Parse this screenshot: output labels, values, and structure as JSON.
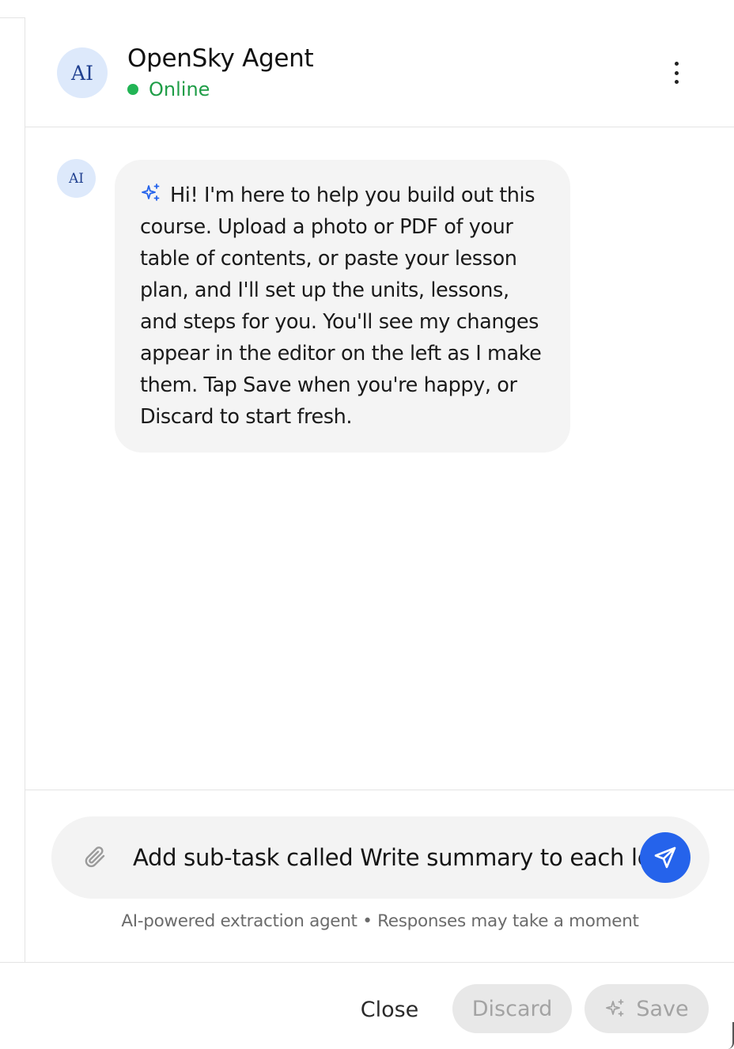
{
  "agent": {
    "avatar_text": "AI",
    "name": "OpenSky Agent",
    "status": "Online",
    "status_color": "#22b455"
  },
  "header": {
    "menu_icon": "more-vertical-icon"
  },
  "messages": [
    {
      "sender": "agent",
      "avatar_text": "AI",
      "icon": "sparkle-icon",
      "text": "Hi! I'm here to help you build out this course. Upload a photo or PDF of your table of contents, or paste your lesson plan, and I'll set up the units, lessons, and steps for you. You'll see my changes appear in the editor on the left as I make them. Tap Save when you're happy, or Discard to start fresh."
    }
  ],
  "composer": {
    "attach_icon": "paperclip-icon",
    "input_value": "Add sub-task called Write summary to each lesson",
    "send_icon": "send-icon",
    "send_color": "#2563eb",
    "footnote": "AI-powered extraction agent • Responses may take a moment"
  },
  "footer": {
    "close_label": "Close",
    "discard_label": "Discard",
    "save_label": "Save",
    "save_icon": "sparkle-icon"
  }
}
